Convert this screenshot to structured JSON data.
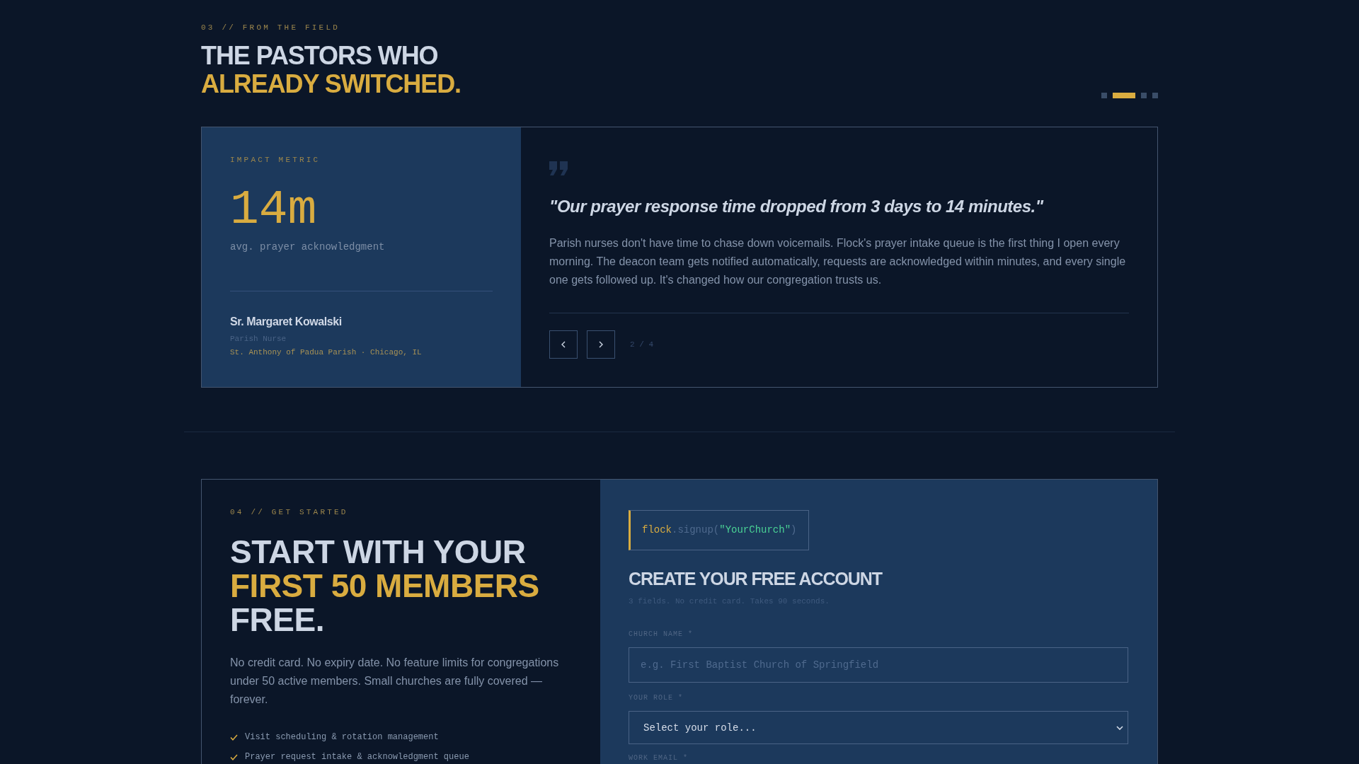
{
  "testimonials": {
    "eyebrow": "03 // FROM THE FIELD",
    "title_lines": [
      {
        "text": "THE PASTORS WHO",
        "accent": false
      },
      {
        "text": "ALREADY SWITCHED.",
        "accent": true
      }
    ],
    "pager": [
      {
        "selected": false
      },
      {
        "selected": true
      },
      {
        "selected": false
      },
      {
        "selected": false
      }
    ],
    "metric": {
      "label": "IMPACT METRIC",
      "value": "14m",
      "caption": "avg. prayer acknowledgment"
    },
    "author": {
      "name": "Sr. Margaret Kowalski",
      "role": "Parish Nurse",
      "parish": "St. Anthony of Padua Parish · Chicago, IL"
    },
    "quote": "\"Our prayer response time dropped from 3 days to 14 minutes.\"",
    "body": "Parish nurses don't have time to chase down voicemails. Flock's prayer intake queue is the first thing I open every morning. The deacon team gets notified automatically, requests are acknowledged within minutes, and every single one gets followed up. It's changed how our congregation trusts us.",
    "counter": "2 / 4"
  },
  "signup": {
    "eyebrow": "04 // GET STARTED",
    "title_lines": [
      {
        "text": "START WITH YOUR",
        "accent": false
      },
      {
        "text": "FIRST 50 MEMBERS",
        "accent": true
      },
      {
        "text": "FREE.",
        "accent": false
      }
    ],
    "description": "No credit card. No expiry date. No feature limits for congregations under 50 active members. Small churches are fully covered — forever.",
    "features": [
      "Visit scheduling & rotation management",
      "Prayer request intake & acknowledgment queue"
    ],
    "code": [
      {
        "kind": "object",
        "text": "flock"
      },
      {
        "kind": "call",
        "text": ".signup("
      },
      {
        "kind": "string",
        "text": "\"YourChurch\""
      },
      {
        "kind": "call",
        "text": ")"
      }
    ],
    "form_title": "CREATE YOUR FREE ACCOUNT",
    "form_note": "3 fields. No credit card. Takes 90 seconds.",
    "fields": [
      {
        "label": "CHURCH NAME *",
        "control": {
          "kind": "text",
          "placeholder": "e.g. First Baptist Church of Springfield"
        }
      },
      {
        "label": "YOUR ROLE *",
        "control": {
          "kind": "select",
          "value": "Select your role..."
        }
      },
      {
        "label": "WORK EMAIL *"
      }
    ]
  }
}
